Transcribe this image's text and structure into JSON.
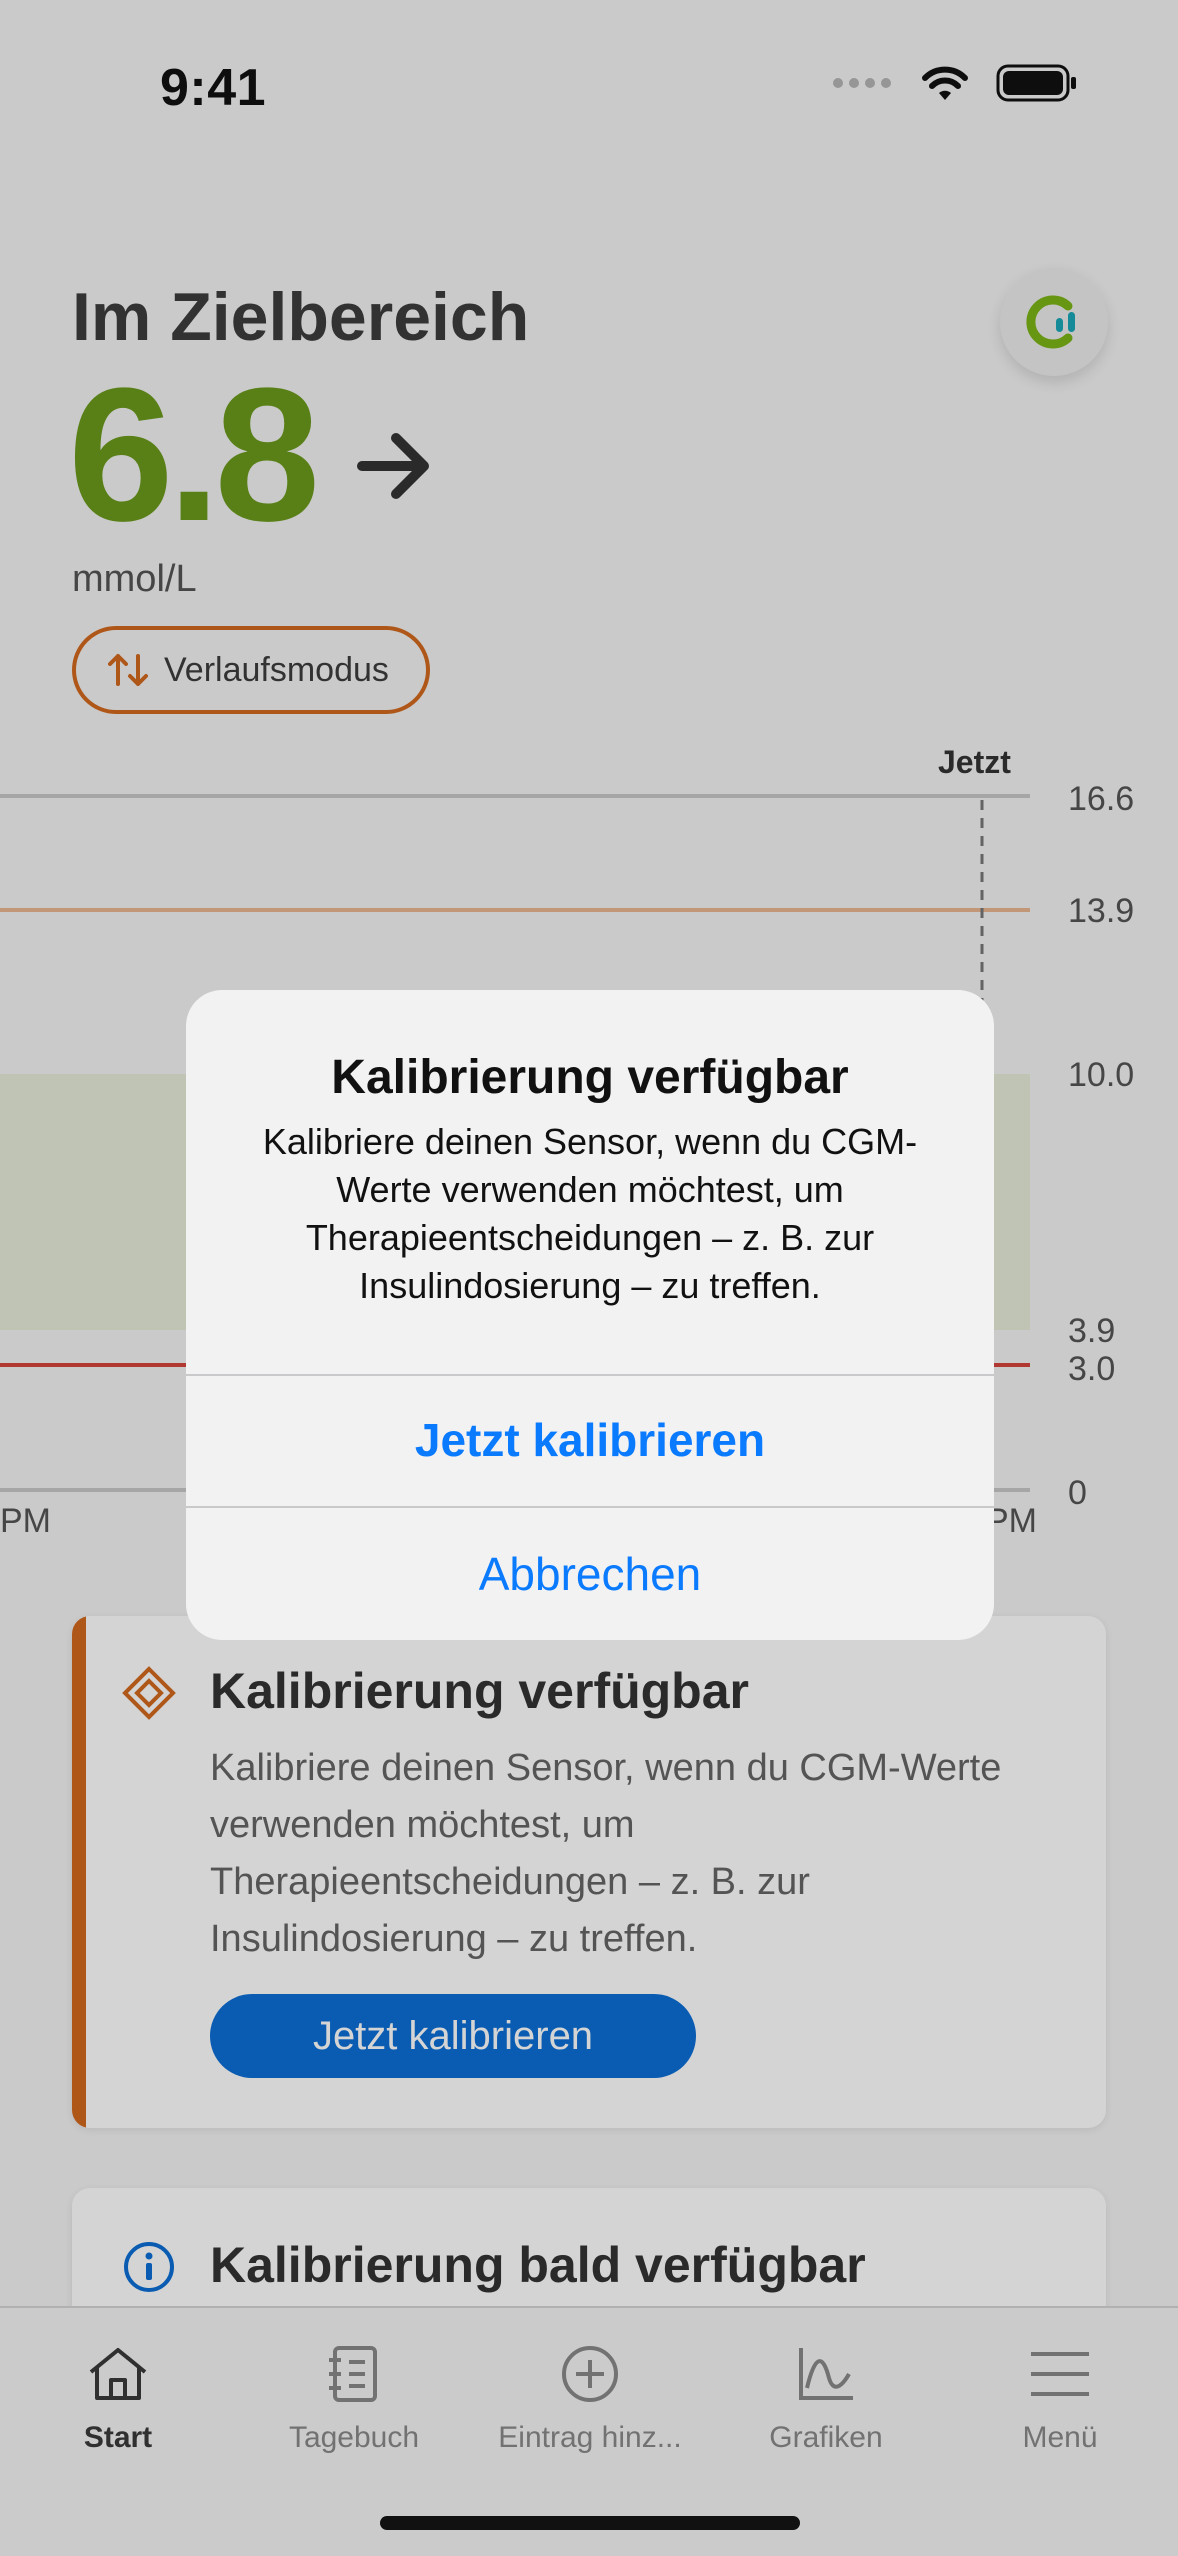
{
  "status_bar": {
    "time": "9:41"
  },
  "header": {
    "zone_title": "Im Zielbereich",
    "glucose_value": "6.8",
    "unit": "mmol/L",
    "mode_button_label": "Verlaufsmodus",
    "trend_icon": "arrow-right-icon",
    "accent_green": "#6a9a1c",
    "accent_orange": "#d2691e"
  },
  "chart": {
    "now_label": "Jetzt",
    "y_ticks": [
      "16.6",
      "13.9",
      "10.0",
      "3.9",
      "3.0",
      "0"
    ],
    "x_tick_left": "PM",
    "x_tick_right": "PM",
    "high_limit_color": "#e8b690",
    "low_limit_color": "#d6453d",
    "target_band_color": "#e7ecd9"
  },
  "cards": {
    "calibration": {
      "title": "Kalibrierung verfügbar",
      "body": "Kalibriere deinen Sensor, wenn du CGM-Werte verwenden möchtest, um Therapieentscheidungen – z. B. zur Insulindosierung – zu treffen.",
      "button_label": "Jetzt kalibrieren",
      "button_color": "#0b6fd6"
    },
    "calibration_soon": {
      "title": "Kalibrierung bald verfügbar"
    }
  },
  "tabbar": {
    "items": [
      {
        "label": "Start",
        "icon": "home-icon",
        "active": true
      },
      {
        "label": "Tagebuch",
        "icon": "logbook-icon",
        "active": false
      },
      {
        "label": "Eintrag hinz...",
        "icon": "add-circle-icon",
        "active": false
      },
      {
        "label": "Grafiken",
        "icon": "chart-icon",
        "active": false
      },
      {
        "label": "Menü",
        "icon": "menu-icon",
        "active": false
      }
    ]
  },
  "dialog": {
    "title": "Kalibrierung verfügbar",
    "message": "Kalibriere deinen Sensor, wenn du CGM-Werte verwenden möchtest, um Therapieentscheidungen – z. B. zur Insulindosierung – zu treffen.",
    "primary_action": "Jetzt kalibrieren",
    "cancel_action": "Abbrechen",
    "action_color": "#0a7aff"
  }
}
